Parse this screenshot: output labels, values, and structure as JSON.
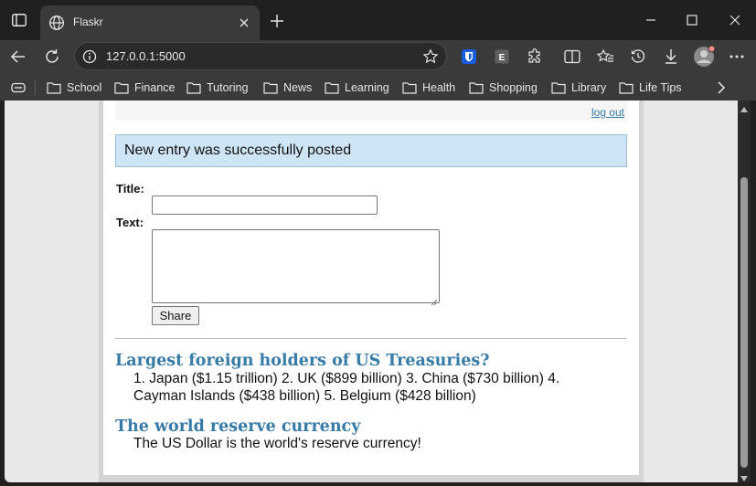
{
  "browser": {
    "tab": {
      "title": "Flaskr",
      "icon": "globe-icon"
    },
    "address": {
      "url": "127.0.0.1:5000",
      "icon": "info-icon"
    },
    "bookmarks": [
      {
        "label": "School"
      },
      {
        "label": "Finance"
      },
      {
        "label": "Tutoring"
      },
      {
        "label": "News"
      },
      {
        "label": "Learning"
      },
      {
        "label": "Health"
      },
      {
        "label": "Shopping"
      },
      {
        "label": "Library"
      },
      {
        "label": "Life Tips"
      }
    ],
    "theme": {
      "chrome": "#202020",
      "toolbar": "#3a3a3a",
      "bitwarden": "#175ddc",
      "profile_dot": "#f28b82"
    }
  },
  "page": {
    "logout": "log out",
    "flash": "New entry was successfully posted",
    "form": {
      "title_label": "Title:",
      "title_value": "",
      "text_label": "Text:",
      "text_value": "",
      "share_button": "Share"
    },
    "entries": [
      {
        "title": "Largest foreign holders of US Treasuries?",
        "text": "1. Japan ($1.15 trillion) 2. UK ($899 billion) 3. China ($730 billion) 4. Cayman Islands ($438 billion) 5. Belgium ($428 billion)"
      },
      {
        "title": "The world reserve currency",
        "text": "The US Dollar is the world's reserve currency!"
      }
    ],
    "colors": {
      "link": "#377ba8",
      "flash_bg": "#cee5f5"
    }
  }
}
